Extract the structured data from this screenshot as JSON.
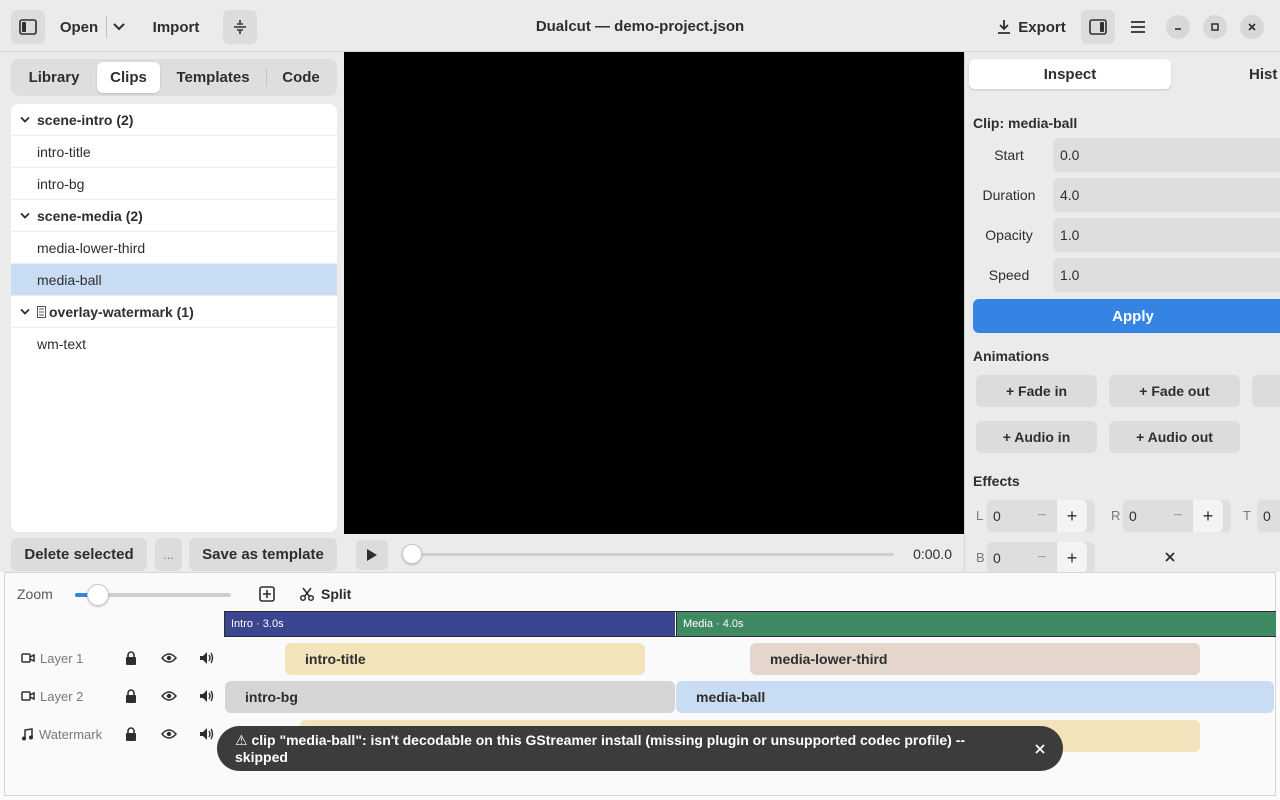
{
  "header": {
    "open_label": "Open",
    "import_label": "Import",
    "title": "Dualcut — demo-project.json",
    "export_label": "Export"
  },
  "left": {
    "tabs": [
      {
        "label": "Library"
      },
      {
        "label": "Clips"
      },
      {
        "label": "Templates"
      },
      {
        "label": "Code"
      }
    ],
    "groups": [
      {
        "label": "scene-intro (2)",
        "items": [
          "intro-title",
          "intro-bg"
        ]
      },
      {
        "label": "scene-media (2)",
        "items": [
          "media-lower-third",
          "media-ball"
        ]
      },
      {
        "label": "overlay-watermark (1)",
        "items": [
          "wm-text"
        ]
      }
    ],
    "delete_label": "Delete selected",
    "more_label": "...",
    "save_template_label": "Save as template"
  },
  "transport": {
    "time": "0:00.0",
    "progress": 0
  },
  "inspector": {
    "tabs": [
      {
        "label": "Inspect"
      },
      {
        "label": "Hist"
      }
    ],
    "clip_heading": "Clip: media-ball",
    "fields": [
      {
        "label": "Start",
        "value": "0.0"
      },
      {
        "label": "Duration",
        "value": "4.0"
      },
      {
        "label": "Opacity",
        "value": "1.0"
      },
      {
        "label": "Speed",
        "value": "1.0"
      }
    ],
    "apply_label": "Apply",
    "animations_heading": "Animations",
    "animations": [
      "+ Fade in",
      "+ Fade out",
      "+ Audio in",
      "+ Audio out"
    ],
    "effects_heading": "Effects",
    "effects": [
      {
        "label": "L",
        "value": "0"
      },
      {
        "label": "R",
        "value": "0"
      },
      {
        "label": "T",
        "value": "0"
      },
      {
        "label": "B",
        "value": "0"
      }
    ]
  },
  "timeline": {
    "zoom_label": "Zoom",
    "zoom_level": 0.15,
    "split_label": "Split",
    "scenes": [
      {
        "label": "Intro · 3.0s",
        "color": "#3b4590"
      },
      {
        "label": "Media · 4.0s",
        "color": "#3f8a63"
      }
    ],
    "layers": [
      {
        "name": "Layer 1"
      },
      {
        "name": "Layer 2"
      },
      {
        "name": "Watermark"
      }
    ],
    "clips": {
      "intro_title": "intro-title",
      "media_lower_third": "media-lower-third",
      "intro_bg": "intro-bg",
      "media_ball": "media-ball"
    }
  },
  "toast": {
    "message": "⚠ clip \"media-ball\": isn't decodable on this GStreamer install (missing plugin or unsupported codec profile) -- skipped"
  },
  "colors": {
    "accent": "#3584e4",
    "selection": "#c8dcf3"
  }
}
